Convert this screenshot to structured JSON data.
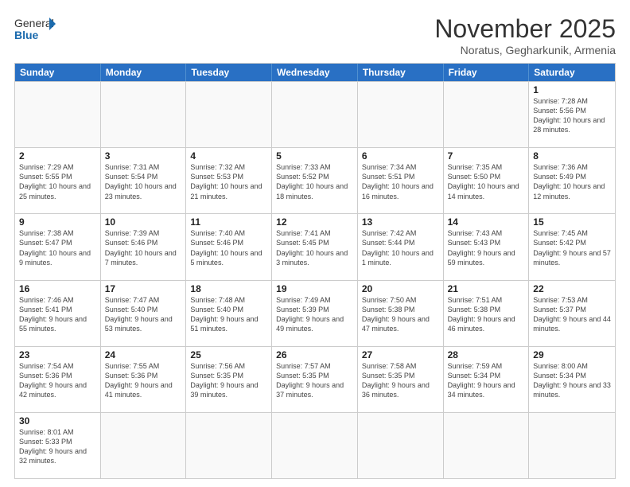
{
  "logo": {
    "text_general": "General",
    "text_blue": "Blue"
  },
  "title": "November 2025",
  "location": "Noratus, Gegharkunik, Armenia",
  "header_days": [
    "Sunday",
    "Monday",
    "Tuesday",
    "Wednesday",
    "Thursday",
    "Friday",
    "Saturday"
  ],
  "weeks": [
    [
      {
        "day": "",
        "info": ""
      },
      {
        "day": "",
        "info": ""
      },
      {
        "day": "",
        "info": ""
      },
      {
        "day": "",
        "info": ""
      },
      {
        "day": "",
        "info": ""
      },
      {
        "day": "",
        "info": ""
      },
      {
        "day": "1",
        "info": "Sunrise: 7:28 AM\nSunset: 5:56 PM\nDaylight: 10 hours and 28 minutes."
      }
    ],
    [
      {
        "day": "2",
        "info": "Sunrise: 7:29 AM\nSunset: 5:55 PM\nDaylight: 10 hours and 25 minutes."
      },
      {
        "day": "3",
        "info": "Sunrise: 7:31 AM\nSunset: 5:54 PM\nDaylight: 10 hours and 23 minutes."
      },
      {
        "day": "4",
        "info": "Sunrise: 7:32 AM\nSunset: 5:53 PM\nDaylight: 10 hours and 21 minutes."
      },
      {
        "day": "5",
        "info": "Sunrise: 7:33 AM\nSunset: 5:52 PM\nDaylight: 10 hours and 18 minutes."
      },
      {
        "day": "6",
        "info": "Sunrise: 7:34 AM\nSunset: 5:51 PM\nDaylight: 10 hours and 16 minutes."
      },
      {
        "day": "7",
        "info": "Sunrise: 7:35 AM\nSunset: 5:50 PM\nDaylight: 10 hours and 14 minutes."
      },
      {
        "day": "8",
        "info": "Sunrise: 7:36 AM\nSunset: 5:49 PM\nDaylight: 10 hours and 12 minutes."
      }
    ],
    [
      {
        "day": "9",
        "info": "Sunrise: 7:38 AM\nSunset: 5:47 PM\nDaylight: 10 hours and 9 minutes."
      },
      {
        "day": "10",
        "info": "Sunrise: 7:39 AM\nSunset: 5:46 PM\nDaylight: 10 hours and 7 minutes."
      },
      {
        "day": "11",
        "info": "Sunrise: 7:40 AM\nSunset: 5:46 PM\nDaylight: 10 hours and 5 minutes."
      },
      {
        "day": "12",
        "info": "Sunrise: 7:41 AM\nSunset: 5:45 PM\nDaylight: 10 hours and 3 minutes."
      },
      {
        "day": "13",
        "info": "Sunrise: 7:42 AM\nSunset: 5:44 PM\nDaylight: 10 hours and 1 minute."
      },
      {
        "day": "14",
        "info": "Sunrise: 7:43 AM\nSunset: 5:43 PM\nDaylight: 9 hours and 59 minutes."
      },
      {
        "day": "15",
        "info": "Sunrise: 7:45 AM\nSunset: 5:42 PM\nDaylight: 9 hours and 57 minutes."
      }
    ],
    [
      {
        "day": "16",
        "info": "Sunrise: 7:46 AM\nSunset: 5:41 PM\nDaylight: 9 hours and 55 minutes."
      },
      {
        "day": "17",
        "info": "Sunrise: 7:47 AM\nSunset: 5:40 PM\nDaylight: 9 hours and 53 minutes."
      },
      {
        "day": "18",
        "info": "Sunrise: 7:48 AM\nSunset: 5:40 PM\nDaylight: 9 hours and 51 minutes."
      },
      {
        "day": "19",
        "info": "Sunrise: 7:49 AM\nSunset: 5:39 PM\nDaylight: 9 hours and 49 minutes."
      },
      {
        "day": "20",
        "info": "Sunrise: 7:50 AM\nSunset: 5:38 PM\nDaylight: 9 hours and 47 minutes."
      },
      {
        "day": "21",
        "info": "Sunrise: 7:51 AM\nSunset: 5:38 PM\nDaylight: 9 hours and 46 minutes."
      },
      {
        "day": "22",
        "info": "Sunrise: 7:53 AM\nSunset: 5:37 PM\nDaylight: 9 hours and 44 minutes."
      }
    ],
    [
      {
        "day": "23",
        "info": "Sunrise: 7:54 AM\nSunset: 5:36 PM\nDaylight: 9 hours and 42 minutes."
      },
      {
        "day": "24",
        "info": "Sunrise: 7:55 AM\nSunset: 5:36 PM\nDaylight: 9 hours and 41 minutes."
      },
      {
        "day": "25",
        "info": "Sunrise: 7:56 AM\nSunset: 5:35 PM\nDaylight: 9 hours and 39 minutes."
      },
      {
        "day": "26",
        "info": "Sunrise: 7:57 AM\nSunset: 5:35 PM\nDaylight: 9 hours and 37 minutes."
      },
      {
        "day": "27",
        "info": "Sunrise: 7:58 AM\nSunset: 5:35 PM\nDaylight: 9 hours and 36 minutes."
      },
      {
        "day": "28",
        "info": "Sunrise: 7:59 AM\nSunset: 5:34 PM\nDaylight: 9 hours and 34 minutes."
      },
      {
        "day": "29",
        "info": "Sunrise: 8:00 AM\nSunset: 5:34 PM\nDaylight: 9 hours and 33 minutes."
      }
    ],
    [
      {
        "day": "30",
        "info": "Sunrise: 8:01 AM\nSunset: 5:33 PM\nDaylight: 9 hours and 32 minutes."
      },
      {
        "day": "",
        "info": ""
      },
      {
        "day": "",
        "info": ""
      },
      {
        "day": "",
        "info": ""
      },
      {
        "day": "",
        "info": ""
      },
      {
        "day": "",
        "info": ""
      },
      {
        "day": "",
        "info": ""
      }
    ]
  ]
}
